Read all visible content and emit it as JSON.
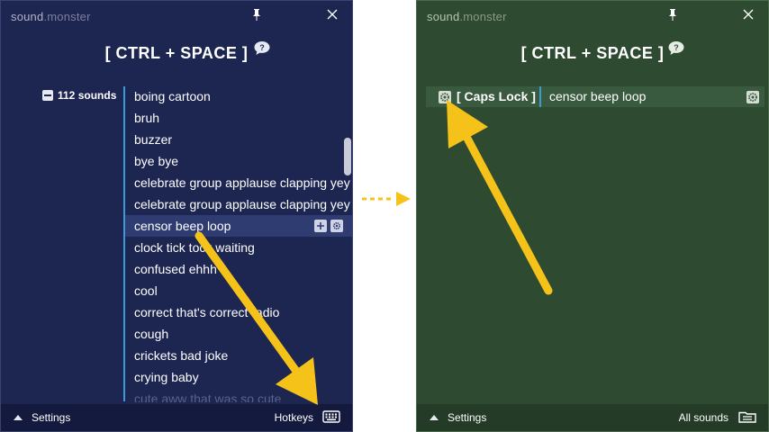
{
  "left_window": {
    "brand_a": "sound",
    "brand_b": ".monster",
    "hotkey_title": "[ CTRL + SPACE ]",
    "sound_count": "112 sounds",
    "sounds": [
      "boing cartoon",
      "bruh",
      "buzzer",
      "bye bye",
      "celebrate group applause clapping yey",
      "celebrate group applause clapping yey",
      "censor beep loop",
      "clock tick tock waiting",
      "confused ehhh",
      "cool",
      "correct that's correct radio",
      "cough",
      "crickets bad joke",
      "crying baby",
      "cute aww that was so cute"
    ],
    "selected_sound": "censor beep loop",
    "footer_settings": "Settings",
    "footer_hotkeys": "Hotkeys",
    "icons": {
      "pin": "pin-icon",
      "close": "close-icon",
      "help": "help-bubble-icon",
      "collapse": "collapse-icon",
      "add": "plus-icon",
      "gear": "gear-icon",
      "keyboard": "keyboard-icon"
    }
  },
  "right_window": {
    "brand_a": "sound",
    "brand_b": ".monster",
    "hotkey_title": "[ CTRL + SPACE ]",
    "assigned_key": "[ Caps Lock ]",
    "assigned_sound": "censor beep loop",
    "footer_settings": "Settings",
    "footer_all_sounds": "All sounds",
    "icons": {
      "pin": "pin-icon",
      "close": "close-icon",
      "help": "help-bubble-icon",
      "gear": "gear-icon",
      "list": "list-icon"
    }
  },
  "colors": {
    "left_bg": "#1d2551",
    "right_bg": "#2e4a31",
    "accent_blue": "#3b9bd9",
    "arrow_yellow": "#f5c21a"
  }
}
